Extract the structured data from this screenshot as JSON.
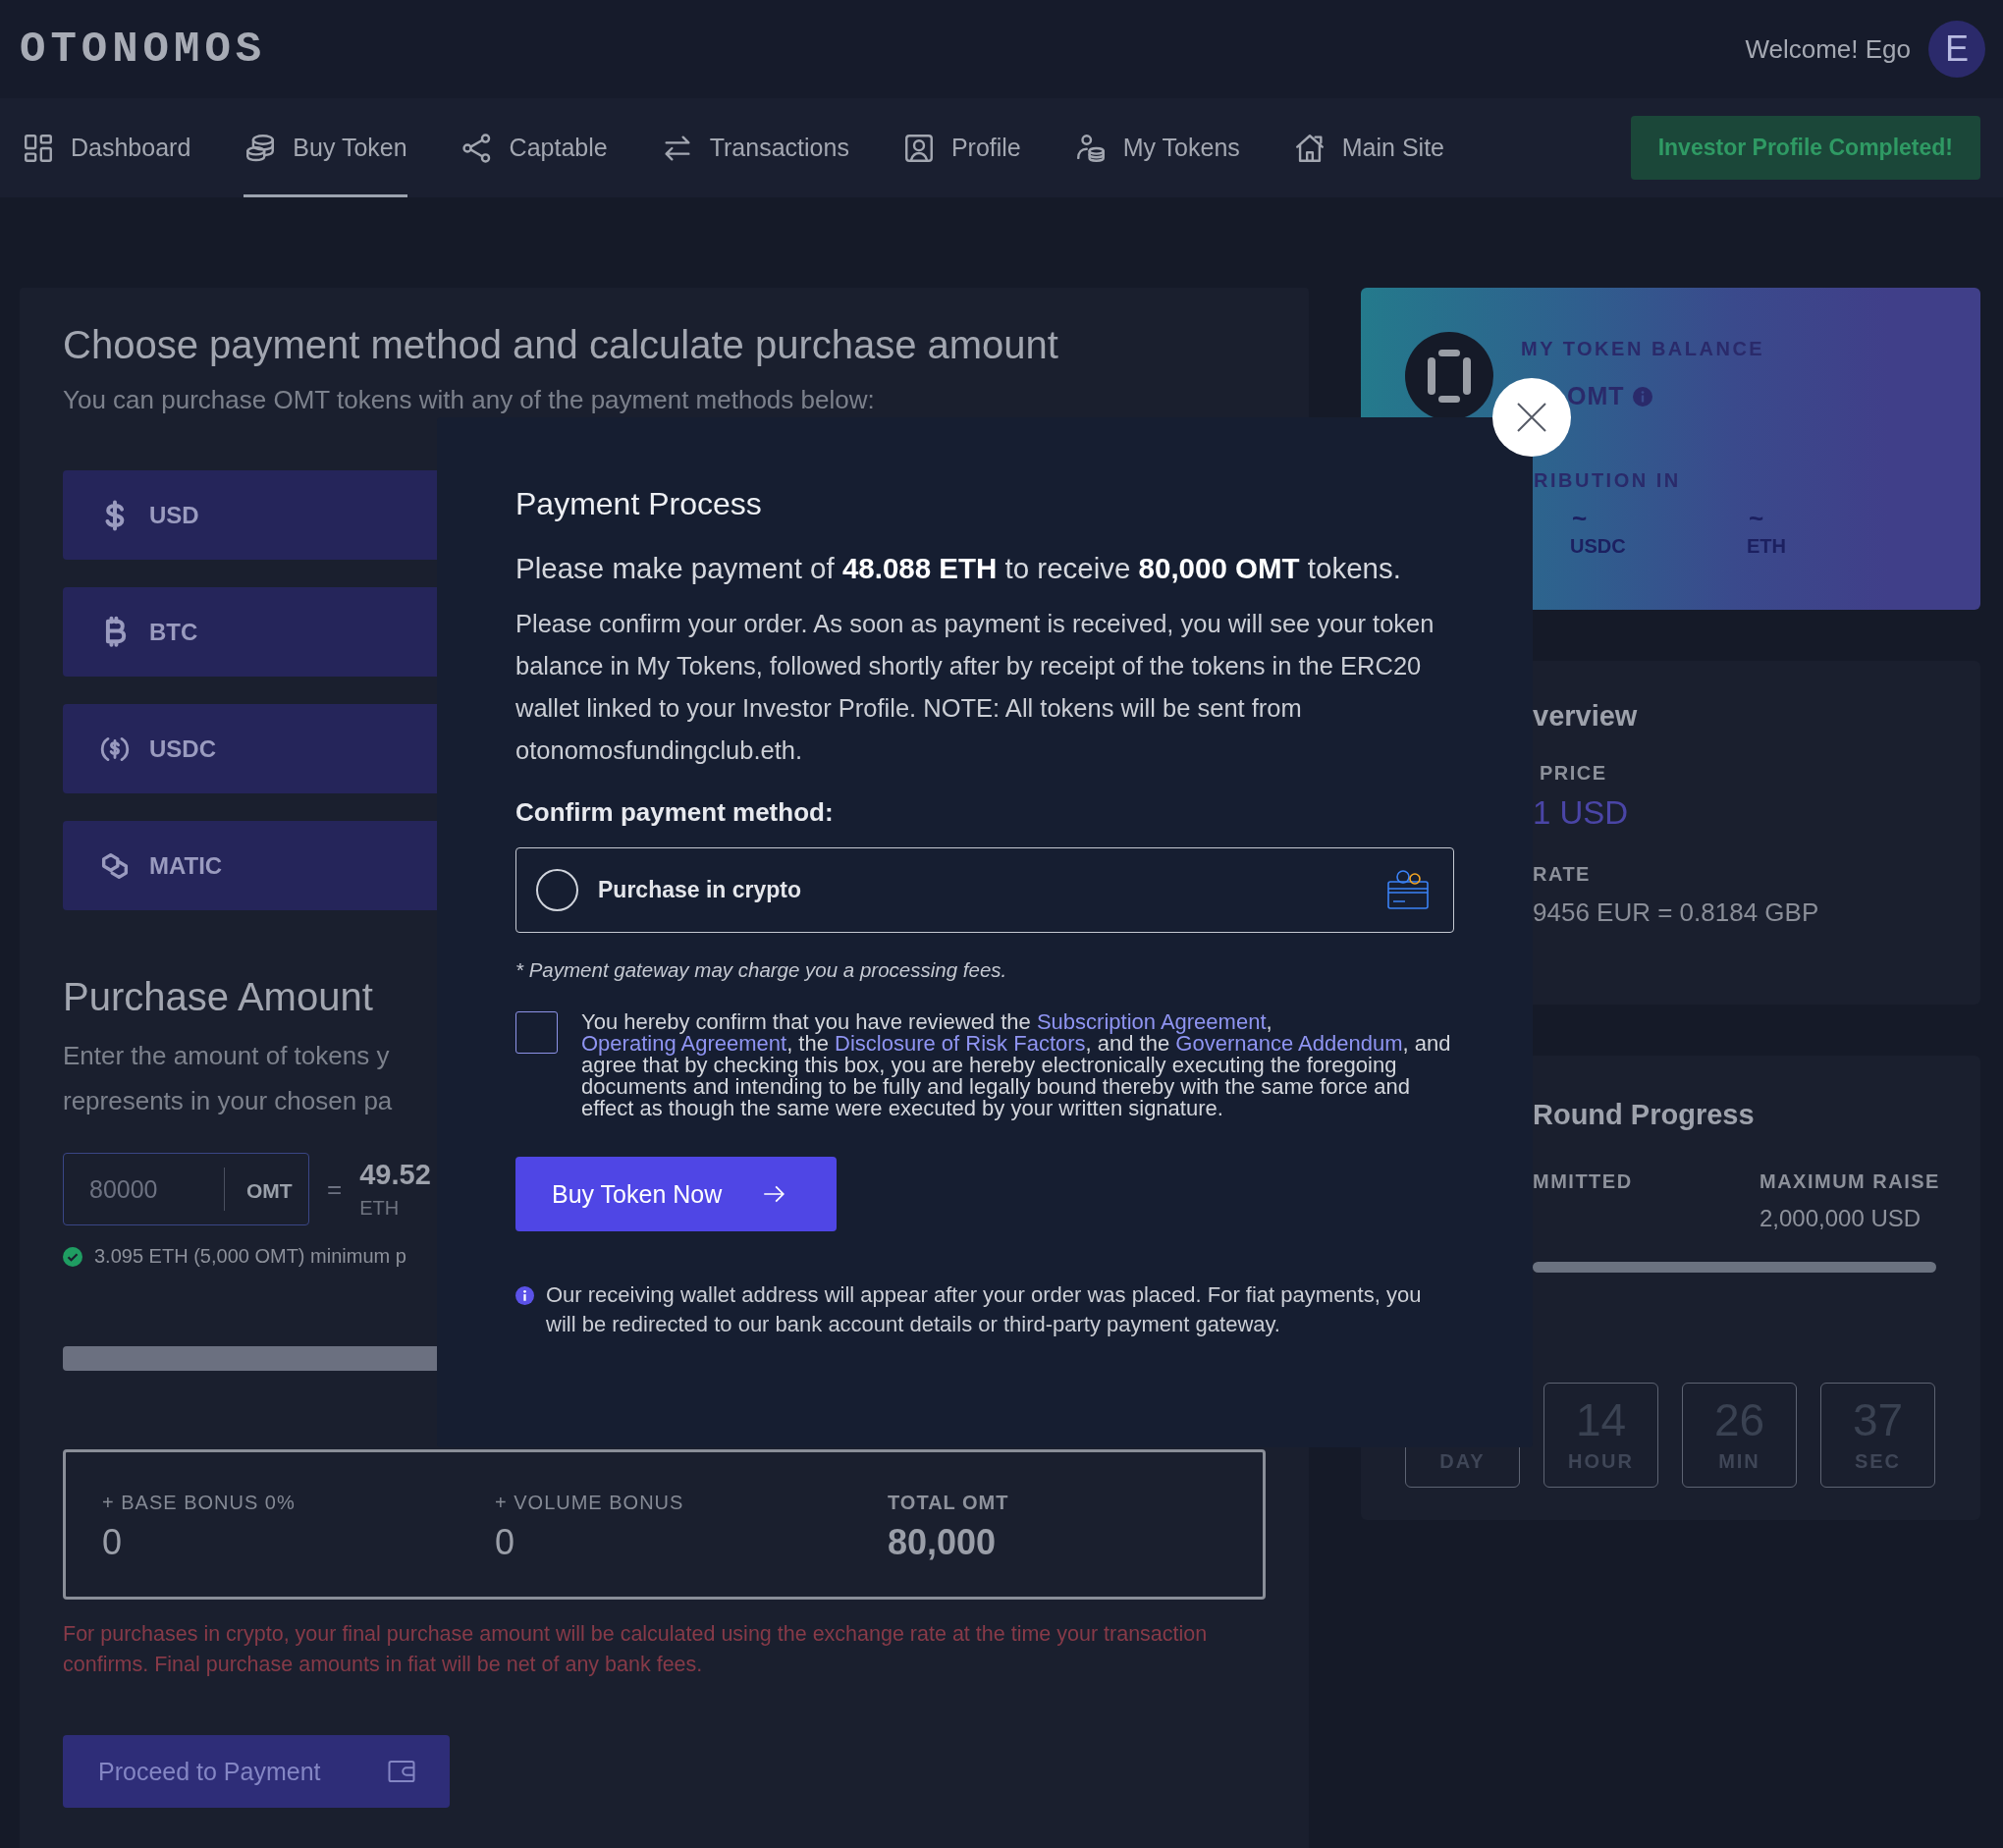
{
  "header": {
    "logo": "OTONOMOS",
    "welcome": "Welcome! Ego",
    "avatar": "E"
  },
  "nav": {
    "items": [
      {
        "label": "Dashboard",
        "selected": false
      },
      {
        "label": "Buy Token",
        "selected": true
      },
      {
        "label": "Captable",
        "selected": false
      },
      {
        "label": "Transactions",
        "selected": false
      },
      {
        "label": "Profile",
        "selected": false
      },
      {
        "label": "My Tokens",
        "selected": false
      },
      {
        "label": "Main Site",
        "selected": false
      }
    ],
    "status_button": "Investor Profile Completed!"
  },
  "purchase": {
    "title": "Choose payment method and calculate purchase amount",
    "subtitle": "You can purchase OMT tokens with any of the payment methods below:",
    "methods": [
      {
        "label": "USD"
      },
      {
        "label": "BTC"
      },
      {
        "label": "USDC"
      },
      {
        "label": "MATIC"
      }
    ],
    "amount_title": "Purchase Amount",
    "amount_text": [
      "Enter the amount of tokens y",
      "represents in your chosen pa"
    ],
    "amount_field": {
      "value": "80000",
      "unit": "OMT"
    },
    "equals": "=",
    "converted": "49.52",
    "converted_unit": "ETH",
    "minimum_note": "3.095 ETH (5,000 OMT) minimum p",
    "bonuses": [
      {
        "label": "+ BASE BONUS 0%",
        "value": "0"
      },
      {
        "label": "+ VOLUME BONUS",
        "value": "0"
      },
      {
        "label": "TOTAL OMT",
        "value": "80,000"
      }
    ],
    "disclaimer": "For purchases in crypto, your final purchase amount will be calculated using the exchange rate at the time your transaction confirms. Final purchase amounts in fiat will be net of any bank fees.",
    "proceed_button": "Proceed to Payment"
  },
  "token_balance": {
    "title": "MY TOKEN BALANCE",
    "balance_unit": "OMT",
    "distribution_label": "RIBUTION IN",
    "currencies": [
      {
        "value": "~",
        "unit": "USDC"
      },
      {
        "value": "~",
        "unit": "ETH"
      }
    ]
  },
  "overview": {
    "title": "verview",
    "price_label": "PRICE",
    "price": "1 USD",
    "rate_label": "RATE",
    "rate": "9456 EUR = 0.8184 GBP"
  },
  "round_progress": {
    "title": "Round Progress",
    "committed_label": "MMITTED",
    "max_label": "MAXIMUM RAISE",
    "max_value": "2,000,000 USD",
    "countdown": [
      {
        "unit": "DAY"
      },
      {
        "value": "14",
        "unit": "HOUR"
      },
      {
        "value": "26",
        "unit": "MIN"
      },
      {
        "value": "37",
        "unit": "SEC"
      }
    ]
  },
  "modal": {
    "title": "Payment Process",
    "lead": "Please make payment of **48.088 ETH** to receive **80,000 OMT** tokens.",
    "body": "Please confirm your order. As soon as payment is received, you will see your token balance in My Tokens, followed shortly after by receipt of the tokens in the ERC20 wallet linked to your Investor Profile. NOTE: All tokens will be sent from otonomosfundingclub.eth.",
    "method_label": "Confirm payment method:",
    "option": {
      "label": "Purchase in crypto",
      "selected": false
    },
    "fee_note": "* Payment gateway may charge you a processing fees.",
    "consent": {
      "checked": false,
      "parts": [
        {
          "kind": "text",
          "text": "You hereby confirm that you have reviewed the "
        },
        {
          "kind": "link",
          "text": "Subscription Agreement"
        },
        {
          "kind": "text",
          "text": ", "
        },
        {
          "kind": "link",
          "text": "Operating Agreement"
        },
        {
          "kind": "text",
          "text": ", the "
        },
        {
          "kind": "link",
          "text": "Disclosure of Risk Factors"
        },
        {
          "kind": "text",
          "text": ", and the "
        },
        {
          "kind": "link",
          "text": "Governance Addendum"
        },
        {
          "kind": "text",
          "text": ", and agree that by checking this box, you are hereby electronically executing the foregoing documents and intending to be fully and legally bound thereby with the same force and effect as though the same were executed by your written signature."
        }
      ]
    },
    "buy_button": "Buy Token Now",
    "info": "Our receiving wallet address will appear after your order was placed. For fiat payments, you will be redirected to our bank account details or third-party payment gateway."
  }
}
